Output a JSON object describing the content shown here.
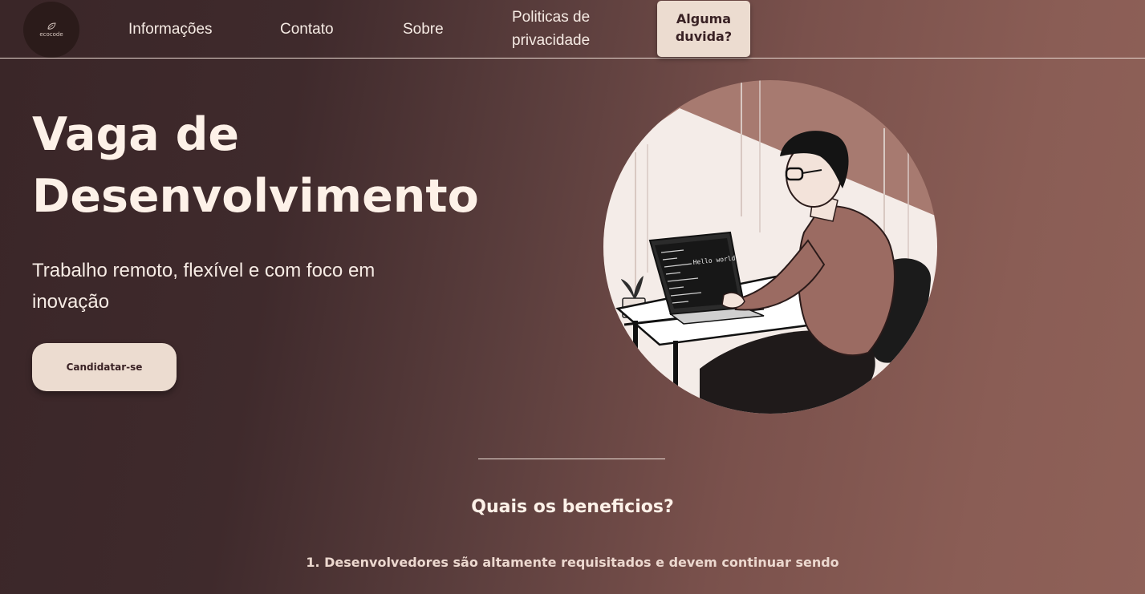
{
  "logo": {
    "text": "ecocode"
  },
  "nav": {
    "links": [
      {
        "label": "Informações"
      },
      {
        "label": "Contato"
      },
      {
        "label": "Sobre"
      },
      {
        "label": "Politicas de privacidade"
      }
    ],
    "cta_label": "Alguma duvida?"
  },
  "hero": {
    "title": "Vaga de Desenvolvimento",
    "subtitle": "Trabalho remoto, flexível e com foco em inovação",
    "button_label": "Candidatar-se",
    "illustration": {
      "icon": "developer-illustration",
      "screen_text": "Hello world"
    }
  },
  "benefits": {
    "title": "Quais os beneficios?",
    "items": [
      "1. Desenvolvedores são altamente requisitados e devem continuar sendo"
    ]
  },
  "colors": {
    "accent": "#ecdcd0",
    "text_light": "#fdf1e8",
    "text_dark": "#3a2225",
    "background_start": "#3a2628",
    "background_end": "#8f6158"
  }
}
